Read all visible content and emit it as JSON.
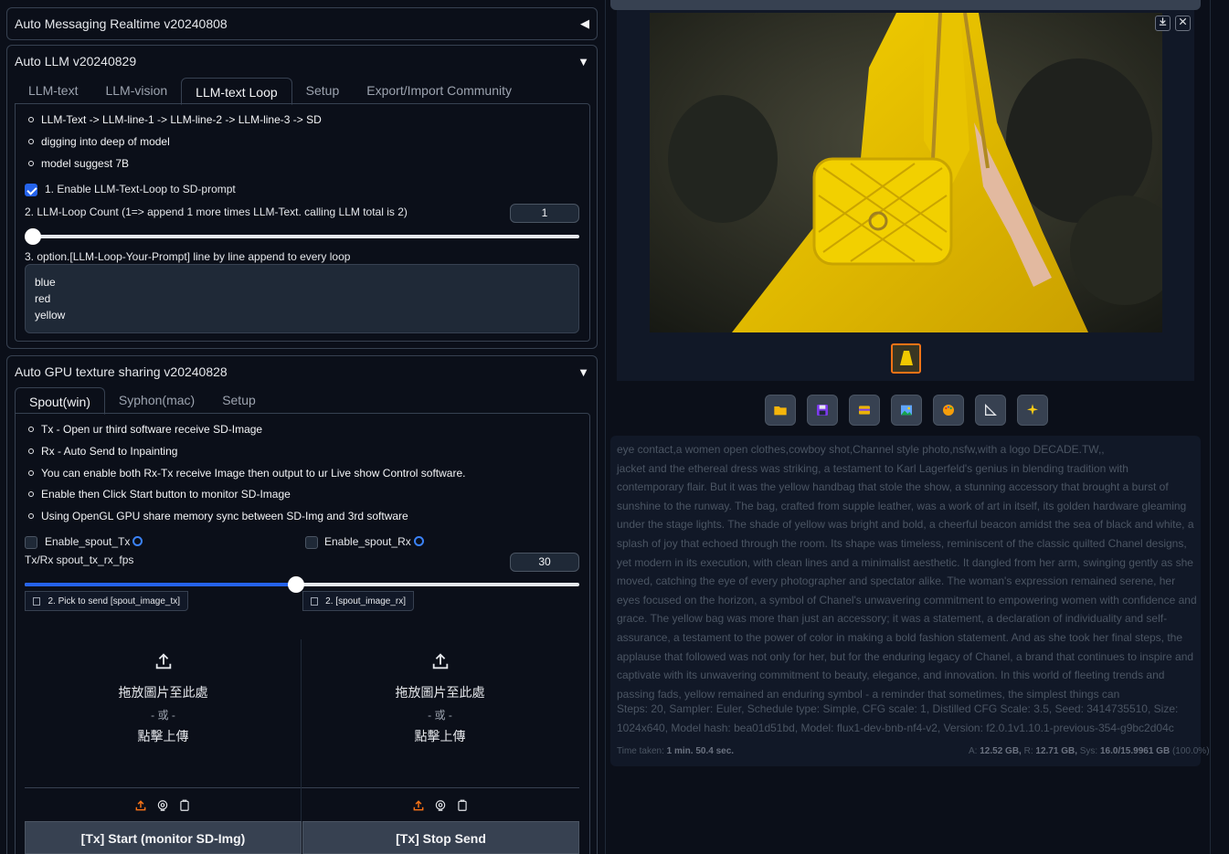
{
  "accordions": {
    "messaging": {
      "title": "Auto Messaging Realtime v20240808",
      "toggle": "◀"
    },
    "llm": {
      "title": "Auto LLM v20240829",
      "toggle": "▼",
      "tabs": [
        "LLM-text",
        "LLM-vision",
        "LLM-text Loop",
        "Setup",
        "Export/Import Community"
      ],
      "active_tab": "LLM-text Loop",
      "bullets": [
        "LLM-Text -> LLM-line-1 -> LLM-line-2 -> LLM-line-3 -> SD",
        "digging into deep of model",
        "model suggest 7B"
      ],
      "enable_label": "1. Enable LLM-Text-Loop to SD-prompt",
      "enable_checked": true,
      "loop_count_label": "2. LLM-Loop Count (1=> append 1 more times LLM-Text. calling LLM total is 2)",
      "loop_count_value": "1",
      "loop_count_fraction": 0.0,
      "loop_prompt_label": "3. option.[LLM-Loop-Your-Prompt] line by line append to every loop",
      "loop_prompt_lines": [
        "blue",
        "red",
        "yellow"
      ]
    },
    "gpu": {
      "title": "Auto GPU texture sharing v20240828",
      "toggle": "▼",
      "tabs": [
        "Spout(win)",
        "Syphon(mac)",
        "Setup"
      ],
      "active_tab": "Spout(win)",
      "bullets": [
        "Tx - Open ur third software receive SD-Image",
        "Rx - Auto Send to Inpainting",
        "You can enable both Rx-Tx receive Image then output to ur Live show Control software.",
        "Enable then Click Start button to monitor SD-Image",
        "Using OpenGL GPU share memory sync between SD-Img and 3rd software"
      ],
      "enable_tx_label": "Enable_spout_Tx",
      "enable_rx_label": "Enable_spout_Rx",
      "fps_label": "Tx/Rx spout_tx_rx_fps",
      "fps_value": "30",
      "fps_fraction": 0.49,
      "tx_image_label": "2. Pick to send [spout_image_tx]",
      "rx_image_label": "2. [spout_image_rx]",
      "drop_text": "拖放圖片至此處",
      "drop_or": "- 或 -",
      "drop_click": "點擊上傳",
      "start_button": "[Tx] Start (monitor SD-Img)",
      "stop_button": "[Tx] Stop Send"
    }
  },
  "gallery": {
    "download_icon": "download-icon",
    "close_icon": "close-icon",
    "toolbar_icons": [
      "folder-icon",
      "save-icon",
      "zip-icon",
      "image-icon",
      "palette-icon",
      "ruler-icon",
      "sparkle-icon"
    ]
  },
  "info": {
    "prompt_head": "eye contact,a women open clothes,cowboy shot,Channel style photo,nsfw,with a logo DECADE.TW,,",
    "prompt_body": "jacket and the ethereal dress was striking, a testament to Karl Lagerfeld's genius in blending tradition with contemporary flair. But it was the yellow handbag that stole the show, a stunning accessory that brought a burst of sunshine to the runway. The bag, crafted from supple leather, was a work of art in itself, its golden hardware gleaming under the stage lights. The shade of yellow was bright and bold, a cheerful beacon amidst the sea of black and white, a splash of joy that echoed through the room. Its shape was timeless, reminiscent of the classic quilted Chanel designs, yet modern in its execution, with clean lines and a minimalist aesthetic. It dangled from her arm, swinging gently as she moved, catching the eye of every photographer and spectator alike. The woman's expression remained serene, her eyes focused on the horizon, a symbol of Chanel's unwavering commitment to empowering women with confidence and grace. The yellow bag was more than just an accessory; it was a statement, a declaration of individuality and self-assurance, a testament to the power of color in making a bold fashion statement. And as she took her final steps, the applause that followed was not only for her, but for the enduring legacy of Chanel, a brand that continues to inspire and captivate with its unwavering commitment to beauty, elegance, and innovation. In this world of fleeting trends and passing fads, yellow remained an enduring symbol - a reminder that sometimes, the simplest things can",
    "params": "Steps: 20, Sampler: Euler, Schedule type: Simple, CFG scale: 1, Distilled CFG Scale: 3.5, Seed: 3414735510, Size: 1024x640, Model hash: bea01d51bd, Model: flux1-dev-bnb-nf4-v2, Version: f2.0.1v1.10.1-previous-354-g9bc2d04c",
    "time_label": "Time taken:",
    "time_value": "1 min. 50.4 sec.",
    "mem_a_label": "A:",
    "mem_a": "12.52 GB,",
    "mem_r_label": "R:",
    "mem_r": "12.71 GB,",
    "mem_sys_label": "Sys:",
    "mem_sys": "16.0/15.9961 GB",
    "mem_pct": "(100.0%)"
  }
}
